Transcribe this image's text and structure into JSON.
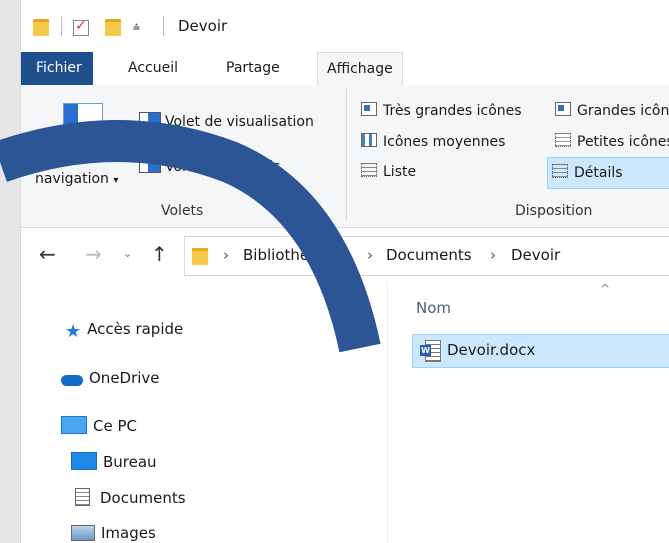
{
  "window": {
    "title": "Devoir"
  },
  "tabs": [
    {
      "label": "Fichier"
    },
    {
      "label": "Accueil"
    },
    {
      "label": "Partage"
    },
    {
      "label": "Affichage"
    }
  ],
  "ribbon": {
    "volets": {
      "navigation_label": "navigation",
      "preview_label": "Volet de visualisation",
      "details_label": "Volet des détails",
      "group_label": "Volets"
    },
    "disposition": {
      "items": [
        {
          "label": "Très grandes icônes"
        },
        {
          "label": "Grandes icônes"
        },
        {
          "label": "Icônes moyennes"
        },
        {
          "label": "Petites icônes"
        },
        {
          "label": "Liste"
        },
        {
          "label": "Détails"
        }
      ],
      "group_label": "Disposition"
    }
  },
  "address": {
    "crumbs": [
      {
        "label": "Bibliothèques"
      },
      {
        "label": "Documents"
      },
      {
        "label": "Devoir"
      }
    ]
  },
  "navpane": {
    "items": [
      {
        "label": "Accès rapide",
        "icon": "star-icon"
      },
      {
        "label": "OneDrive",
        "icon": "cloud-icon"
      },
      {
        "label": "Ce PC",
        "icon": "computer-icon"
      },
      {
        "label": "Bureau",
        "icon": "desktop-icon"
      },
      {
        "label": "Documents",
        "icon": "document-icon"
      },
      {
        "label": "Images",
        "icon": "image-icon"
      }
    ]
  },
  "filepane": {
    "column_header": "Nom",
    "files": [
      {
        "name": "Devoir.docx",
        "icon": "word-document-icon"
      }
    ]
  },
  "colors": {
    "file_tab": "#1f4f8d",
    "selection": "#cce8ff",
    "arc": "#2c5596"
  }
}
